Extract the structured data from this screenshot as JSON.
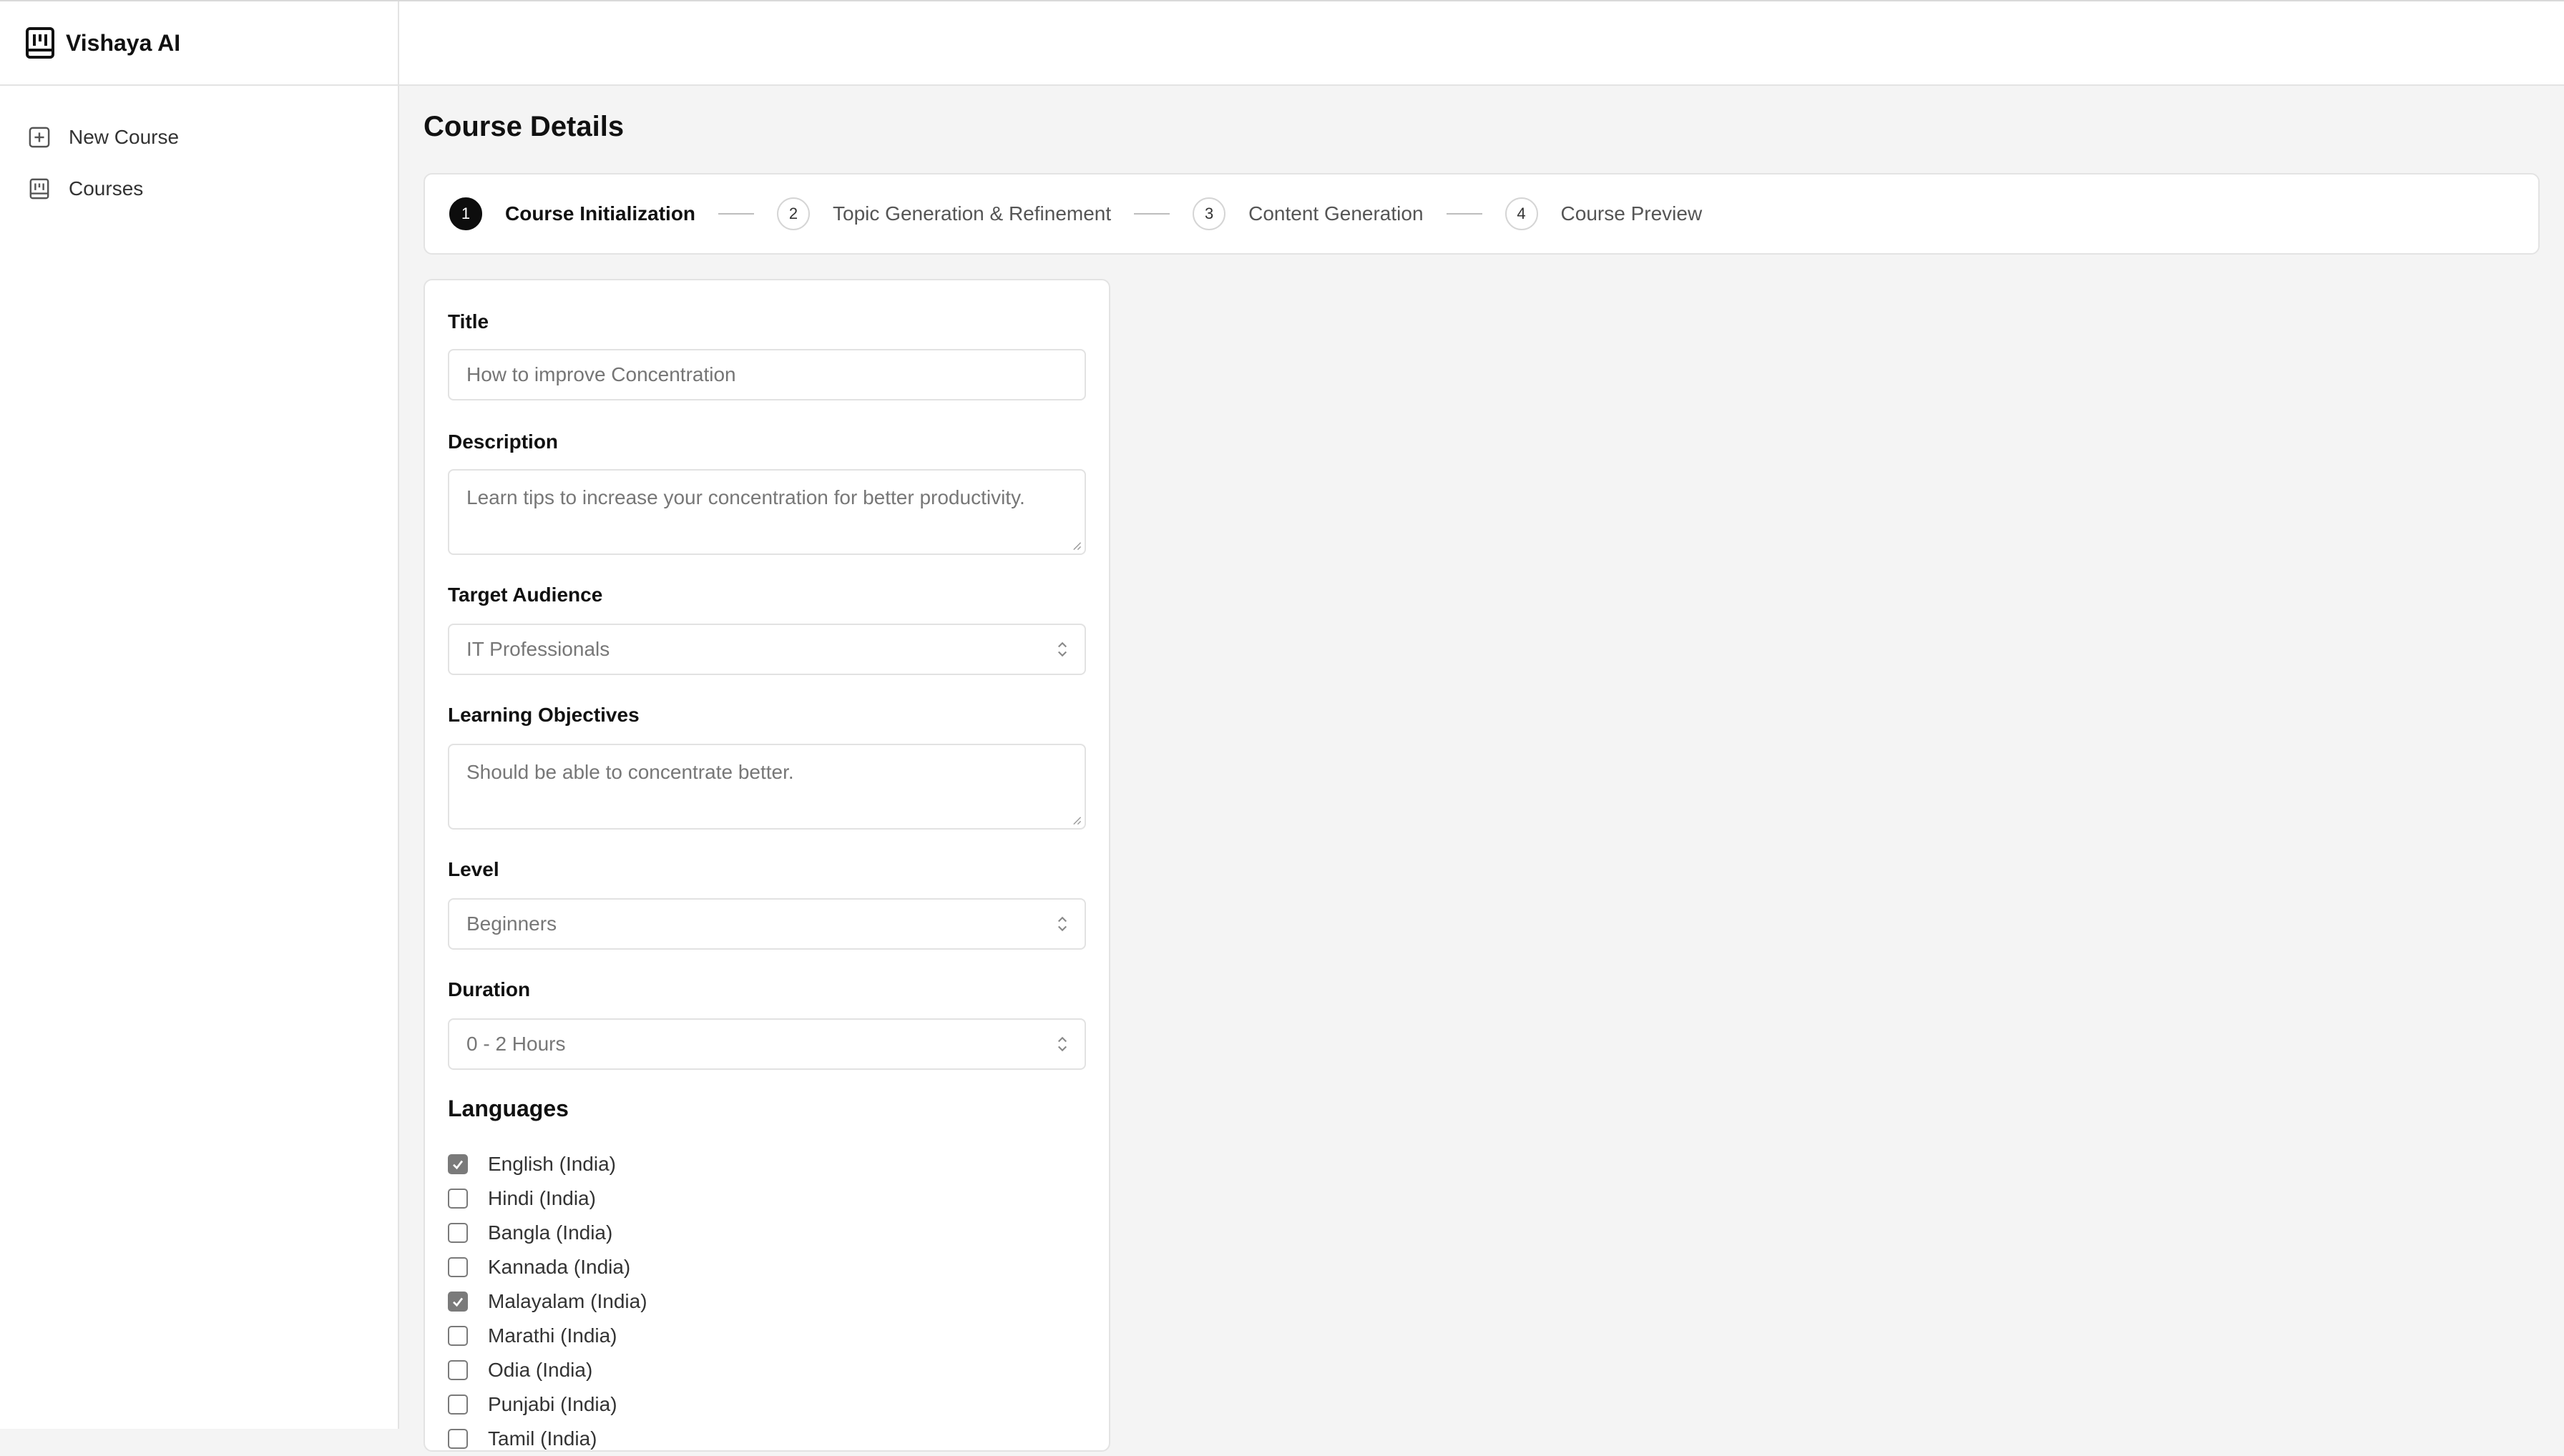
{
  "app": {
    "name": "Vishaya AI"
  },
  "sidebar": {
    "items": [
      {
        "label": "New Course",
        "icon": "plus-square-icon"
      },
      {
        "label": "Courses",
        "icon": "book-icon"
      }
    ]
  },
  "page": {
    "title": "Course Details"
  },
  "stepper": {
    "steps": [
      {
        "number": "1",
        "label": "Course Initialization",
        "active": true
      },
      {
        "number": "2",
        "label": "Topic Generation & Refinement",
        "active": false
      },
      {
        "number": "3",
        "label": "Content Generation",
        "active": false
      },
      {
        "number": "4",
        "label": "Course Preview",
        "active": false
      }
    ]
  },
  "form": {
    "title": {
      "label": "Title",
      "placeholder": "How to improve Concentration"
    },
    "description": {
      "label": "Description",
      "placeholder": "Learn tips to increase your concentration for better productivity."
    },
    "target_audience": {
      "label": "Target Audience",
      "value": "IT Professionals"
    },
    "learning_objectives": {
      "label": "Learning Objectives",
      "placeholder": "Should be able to concentrate better."
    },
    "level": {
      "label": "Level",
      "value": "Beginners"
    },
    "duration": {
      "label": "Duration",
      "value": "0 - 2 Hours"
    },
    "languages": {
      "title": "Languages",
      "items": [
        {
          "label": "English (India)",
          "checked": true
        },
        {
          "label": "Hindi (India)",
          "checked": false
        },
        {
          "label": "Bangla (India)",
          "checked": false
        },
        {
          "label": "Kannada (India)",
          "checked": false
        },
        {
          "label": "Malayalam (India)",
          "checked": true
        },
        {
          "label": "Marathi (India)",
          "checked": false
        },
        {
          "label": "Odia (India)",
          "checked": false
        },
        {
          "label": "Punjabi (India)",
          "checked": false
        },
        {
          "label": "Tamil (India)",
          "checked": false
        }
      ]
    }
  },
  "colors": {
    "accent": "#0d0d0d",
    "background": "#f4f4f4",
    "checkbox": "#7a7a7a"
  }
}
